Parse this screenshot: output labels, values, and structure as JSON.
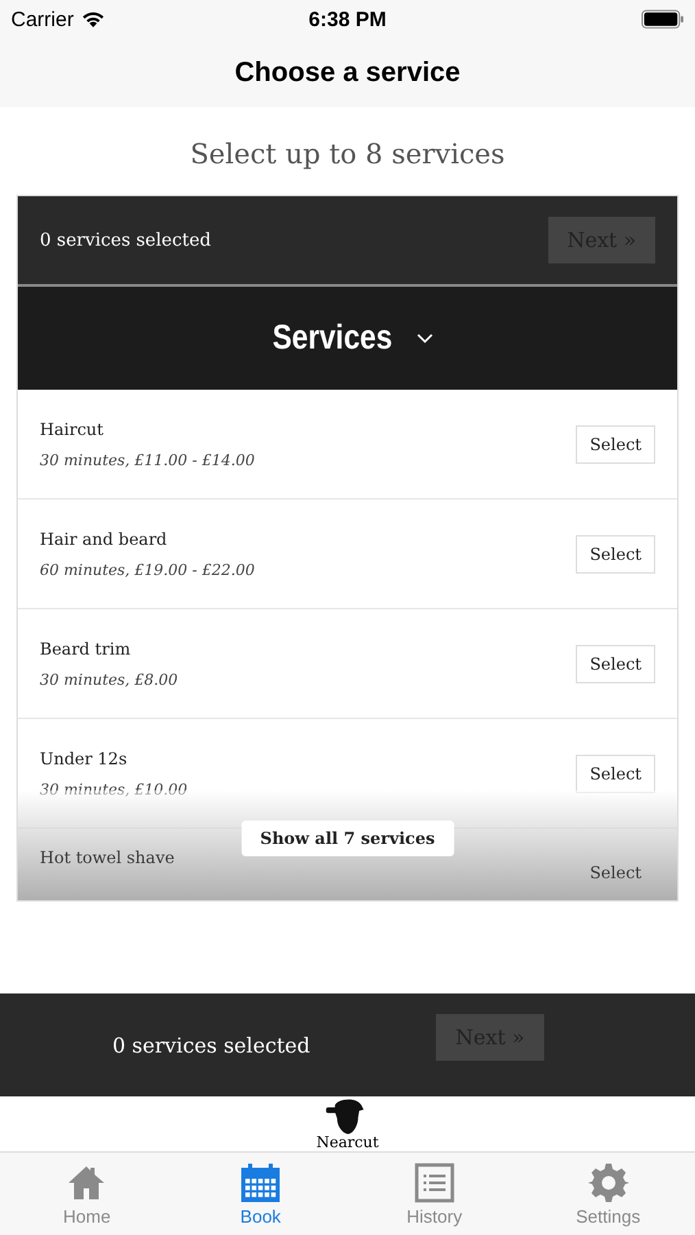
{
  "status_bar": {
    "carrier": "Carrier",
    "time": "6:38 PM"
  },
  "nav": {
    "title": "Choose a service"
  },
  "heading": "Select up to 8 services",
  "top_bar": {
    "count": "0 services selected",
    "next": {
      "label": "Next »",
      "disabled": true
    }
  },
  "services": {
    "title": "Services",
    "expanded": false,
    "items": [
      {
        "name": "Haircut",
        "details": "30 minutes, £11.00 - £14.00",
        "action": "Select"
      },
      {
        "name": "Hair and beard",
        "details": "60 minutes, £19.00 - £22.00",
        "action": "Select"
      },
      {
        "name": "Beard trim",
        "details": "30 minutes, £8.00",
        "action": "Select"
      },
      {
        "name": "Under 12s",
        "details": "30 minutes, £10.00",
        "action": "Select"
      },
      {
        "name": "Hot towel shave",
        "action": "Select"
      }
    ],
    "show_all": "Show all 7 services"
  },
  "bottom_bar": {
    "count": "0 services selected",
    "next": {
      "label": "Next »",
      "disabled": true
    }
  },
  "brand": "Nearcut",
  "tabs": [
    {
      "label": "Home",
      "kind": "home",
      "selected": false
    },
    {
      "label": "Book",
      "kind": "calendar",
      "selected": true
    },
    {
      "label": "History",
      "kind": "list",
      "selected": false
    },
    {
      "label": "Settings",
      "kind": "gear",
      "selected": false
    }
  ]
}
